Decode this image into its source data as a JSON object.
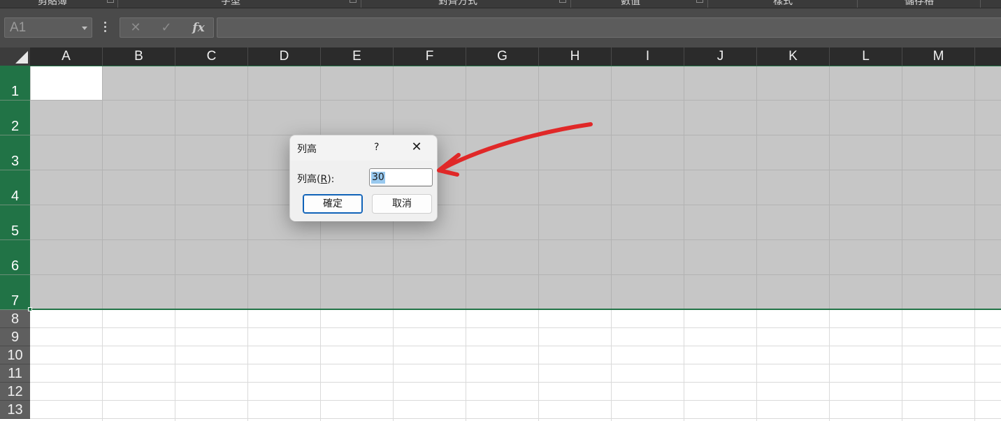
{
  "ribbon": {
    "groups": [
      "剪貼簿",
      "字型",
      "對齊方式",
      "數值",
      "樣式",
      "儲存格"
    ]
  },
  "formula_bar": {
    "name_box": "A1",
    "cancel_icon": "✕",
    "enter_icon": "✓",
    "fx_label": "fx",
    "content": ""
  },
  "columns": [
    "A",
    "B",
    "C",
    "D",
    "E",
    "F",
    "G",
    "H",
    "I",
    "J",
    "K",
    "L",
    "M"
  ],
  "rows": [
    "1",
    "2",
    "3",
    "4",
    "5",
    "6",
    "7",
    "8",
    "9",
    "10",
    "11",
    "12",
    "13"
  ],
  "dialog": {
    "title": "列高",
    "help": "?",
    "close": "✕",
    "label_prefix": "列高(",
    "label_key": "R",
    "label_suffix": "):",
    "value": "30",
    "ok": "確定",
    "cancel": "取消"
  },
  "colors": {
    "selection_green": "#217346",
    "annotation_red": "#e02828"
  }
}
